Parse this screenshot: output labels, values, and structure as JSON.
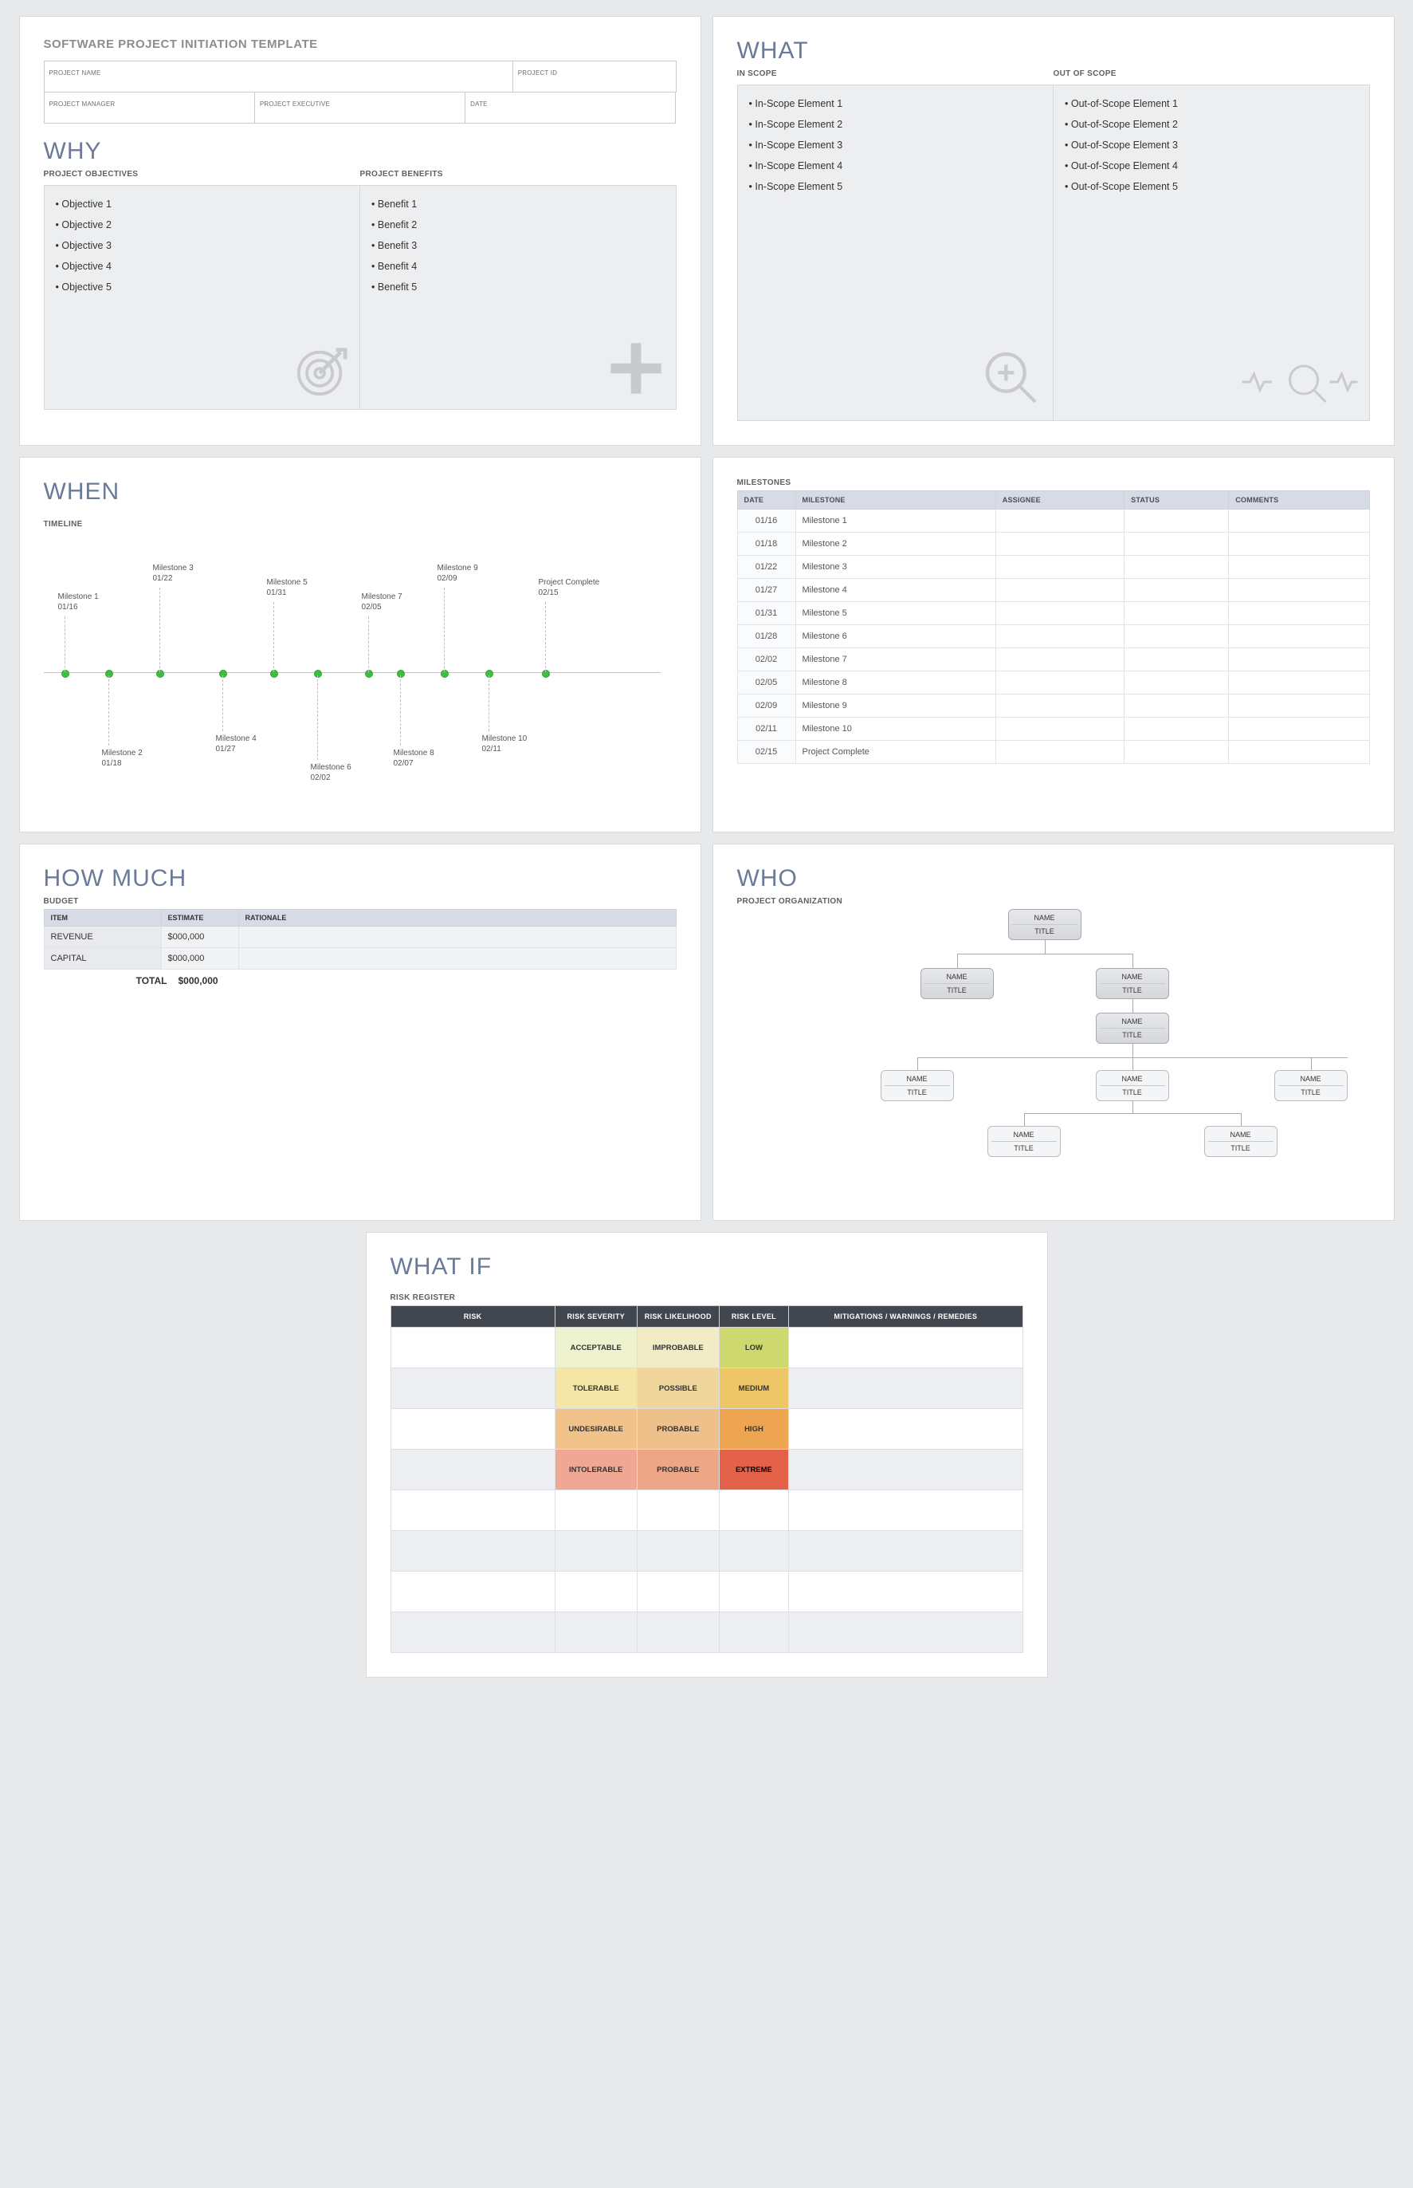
{
  "doc_title": "SOFTWARE PROJECT INITIATION TEMPLATE",
  "meta": {
    "project_name": "PROJECT NAME",
    "project_id": "PROJECT ID",
    "project_manager": "PROJECT MANAGER",
    "project_executive": "PROJECT EXECUTIVE",
    "date": "DATE"
  },
  "why": {
    "title": "WHY",
    "objectives_label": "PROJECT OBJECTIVES",
    "benefits_label": "PROJECT BENEFITS",
    "objectives": [
      "Objective 1",
      "Objective 2",
      "Objective 3",
      "Objective 4",
      "Objective 5"
    ],
    "benefits": [
      "Benefit 1",
      "Benefit 2",
      "Benefit 3",
      "Benefit 4",
      "Benefit 5"
    ]
  },
  "what": {
    "title": "WHAT",
    "in_label": "IN SCOPE",
    "out_label": "OUT OF SCOPE",
    "in_scope": [
      "In-Scope Element 1",
      "In-Scope Element 2",
      "In-Scope Element 3",
      "In-Scope Element 4",
      "In-Scope Element 5"
    ],
    "out_scope": [
      "Out-of-Scope Element 1",
      "Out-of-Scope Element 2",
      "Out-of-Scope Element 3",
      "Out-of-Scope Element 4",
      "Out-of-Scope Element 5"
    ]
  },
  "when": {
    "title": "WHEN",
    "timeline_label": "TIMELINE",
    "milestones_label": "MILESTONES",
    "headers": {
      "date": "DATE",
      "milestone": "MILESTONE",
      "assignee": "ASSIGNEE",
      "status": "STATUS",
      "comments": "COMMENTS"
    },
    "rows": [
      {
        "date": "01/16",
        "name": "Milestone 1"
      },
      {
        "date": "01/18",
        "name": "Milestone 2"
      },
      {
        "date": "01/22",
        "name": "Milestone 3"
      },
      {
        "date": "01/27",
        "name": "Milestone 4"
      },
      {
        "date": "01/31",
        "name": "Milestone 5"
      },
      {
        "date": "01/28",
        "name": "Milestone 6"
      },
      {
        "date": "02/02",
        "name": "Milestone 7"
      },
      {
        "date": "02/05",
        "name": "Milestone 8"
      },
      {
        "date": "02/09",
        "name": "Milestone 9"
      },
      {
        "date": "02/11",
        "name": "Milestone 10"
      },
      {
        "date": "02/15",
        "name": "Project Complete"
      }
    ]
  },
  "howmuch": {
    "title": "HOW MUCH",
    "budget_label": "BUDGET",
    "headers": {
      "item": "ITEM",
      "estimate": "ESTIMATE",
      "rationale": "RATIONALE"
    },
    "rows": [
      {
        "item": "REVENUE",
        "estimate": "$000,000",
        "rationale": ""
      },
      {
        "item": "CAPITAL",
        "estimate": "$000,000",
        "rationale": ""
      }
    ],
    "total_label": "TOTAL",
    "total_value": "$000,000"
  },
  "who": {
    "title": "WHO",
    "org_label": "PROJECT ORGANIZATION",
    "name": "NAME",
    "title_text": "TITLE"
  },
  "whatif": {
    "title": "WHAT IF",
    "risk_label": "RISK REGISTER",
    "headers": {
      "risk": "RISK",
      "severity": "RISK SEVERITY",
      "likelihood": "RISK LIKELIHOOD",
      "level": "RISK LEVEL",
      "mitigations": "MITIGATIONS / WARNINGS / REMEDIES"
    },
    "rows": [
      {
        "sev": "ACCEPTABLE",
        "like": "IMPROBABLE",
        "level": "LOW"
      },
      {
        "sev": "TOLERABLE",
        "like": "POSSIBLE",
        "level": "MEDIUM"
      },
      {
        "sev": "UNDESIRABLE",
        "like": "PROBABLE",
        "level": "HIGH"
      },
      {
        "sev": "INTOLERABLE",
        "like": "PROBABLE",
        "level": "EXTREME"
      }
    ]
  },
  "chart_data": {
    "type": "scatter",
    "title": "TIMELINE",
    "x_axis": "date",
    "points": [
      {
        "x": "01/16",
        "pos": 0.02,
        "label": "Milestone 1",
        "side": "top"
      },
      {
        "x": "01/18",
        "pos": 0.09,
        "label": "Milestone 2",
        "side": "bottom"
      },
      {
        "x": "01/22",
        "pos": 0.17,
        "label": "Milestone 3",
        "side": "top"
      },
      {
        "x": "01/27",
        "pos": 0.27,
        "label": "Milestone 4",
        "side": "bottom"
      },
      {
        "x": "01/31",
        "pos": 0.35,
        "label": "Milestone 5",
        "side": "top"
      },
      {
        "x": "02/02",
        "pos": 0.42,
        "label": "Milestone 6",
        "side": "bottom"
      },
      {
        "x": "02/05",
        "pos": 0.5,
        "label": "Milestone 7",
        "side": "top"
      },
      {
        "x": "02/07",
        "pos": 0.55,
        "label": "Milestone 8",
        "side": "bottom"
      },
      {
        "x": "02/09",
        "pos": 0.62,
        "label": "Milestone 9",
        "side": "top"
      },
      {
        "x": "02/11",
        "pos": 0.69,
        "label": "Milestone 10",
        "side": "bottom"
      },
      {
        "x": "02/15",
        "pos": 0.78,
        "label": "Project Complete",
        "side": "top"
      }
    ]
  }
}
